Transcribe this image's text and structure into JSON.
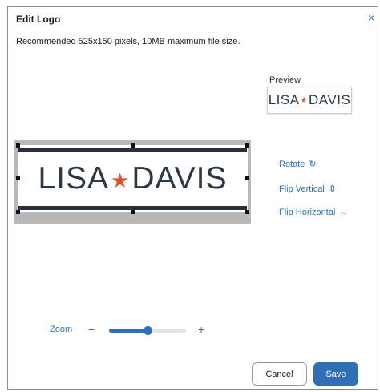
{
  "dialog": {
    "title": "Edit Logo",
    "close_icon": "×",
    "subtitle": "Recommended 525x150 pixels, 10MB maximum file size."
  },
  "preview": {
    "label": "Preview",
    "logo_left": "LISA",
    "logo_star": "★",
    "logo_right": "DAVIS"
  },
  "logo": {
    "left": "LISA",
    "star": "★",
    "right": "DAVIS"
  },
  "actions": {
    "rotate_label": "Rotate",
    "rotate_icon": "↻",
    "flip_vertical_label": "Flip Vertical",
    "flip_vertical_icon": "⇕",
    "flip_horizontal_label": "Flip Horizontal",
    "flip_horizontal_icon": "⇔"
  },
  "zoom": {
    "label": "Zoom",
    "minus": "−",
    "plus": "+",
    "level_fraction": 0.5
  },
  "buttons": {
    "cancel": "Cancel",
    "save": "Save"
  },
  "colors": {
    "accent": "#2f6fb8",
    "star": "#e0502a",
    "logo_text": "#2b3846"
  }
}
